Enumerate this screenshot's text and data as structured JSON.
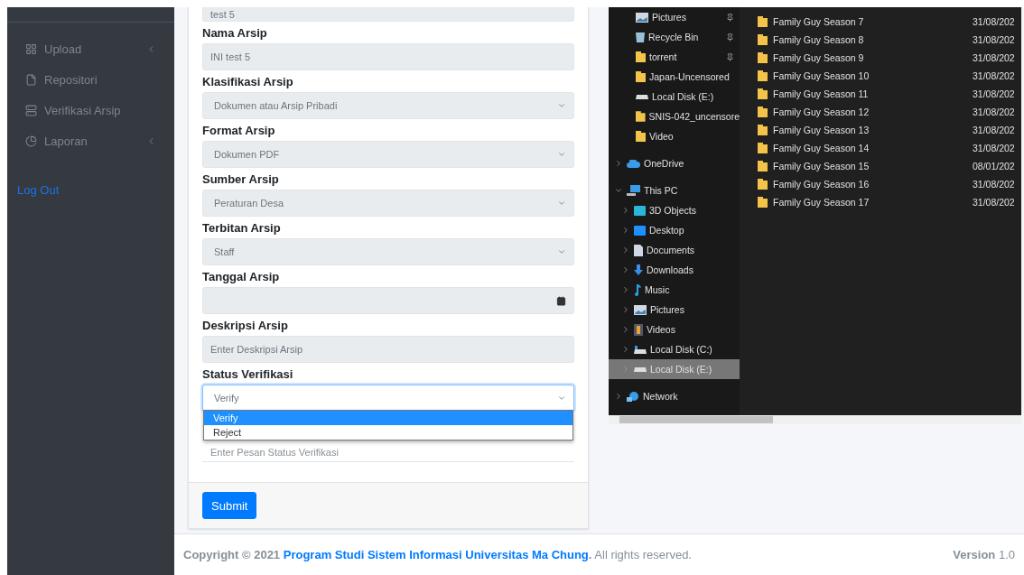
{
  "sidebar": {
    "items": [
      {
        "label": "Upload",
        "has_submenu": true
      },
      {
        "label": "Repositori",
        "has_submenu": false
      },
      {
        "label": "Verifikasi Arsip",
        "has_submenu": false
      },
      {
        "label": "Laporan",
        "has_submenu": true
      }
    ],
    "logout": "Log Out"
  },
  "form": {
    "top_value": "test 5",
    "fields": [
      {
        "label": "Nama Arsip",
        "kind": "input",
        "value": "INI test 5"
      },
      {
        "label": "Klasifikasi Arsip",
        "kind": "select",
        "value": "Dokumen atau Arsip Pribadi"
      },
      {
        "label": "Format Arsip",
        "kind": "select",
        "value": "Dokumen PDF"
      },
      {
        "label": "Sumber Arsip",
        "kind": "select",
        "value": "Peraturan Desa"
      },
      {
        "label": "Terbitan Arsip",
        "kind": "select",
        "value": "Staff"
      },
      {
        "label": "Tanggal Arsip",
        "kind": "date"
      },
      {
        "label": "Deskripsi Arsip",
        "kind": "input",
        "placeholder": "Enter Deskripsi Arsip"
      }
    ],
    "status": {
      "label": "Status Verifikasi",
      "value": "Verify",
      "options": [
        {
          "label": "Verify",
          "selected": true
        },
        {
          "label": "Reject",
          "selected": false
        }
      ]
    },
    "message_placeholder": "Enter Pesan Status Verifikasi",
    "submit": "Submit"
  },
  "explorer": {
    "nav": [
      {
        "label": "Pictures",
        "pinned": true,
        "selected": false
      },
      {
        "label": "Recycle Bin",
        "pinned": true,
        "selected": false
      },
      {
        "label": "torrent",
        "pinned": true,
        "selected": false
      },
      {
        "label": "Japan-Uncensored",
        "pinned": false,
        "selected": false
      },
      {
        "label": "Local Disk (E:)",
        "pinned": false,
        "selected": false
      },
      {
        "label": "SNIS-042_uncensore",
        "pinned": false,
        "selected": false
      },
      {
        "label": "Video",
        "pinned": false,
        "selected": false
      },
      {
        "label": "OneDrive",
        "expanded": false,
        "selected": false
      },
      {
        "label": "This PC",
        "expanded": true,
        "selected": false,
        "children": [
          {
            "label": "3D Objects",
            "selected": false
          },
          {
            "label": "Desktop",
            "selected": false
          },
          {
            "label": "Documents",
            "selected": false
          },
          {
            "label": "Downloads",
            "selected": false
          },
          {
            "label": "Music",
            "selected": false
          },
          {
            "label": "Pictures",
            "selected": false
          },
          {
            "label": "Videos",
            "selected": false
          },
          {
            "label": "Local Disk (C:)",
            "selected": false
          },
          {
            "label": "Local Disk (E:)",
            "selected": true
          }
        ]
      },
      {
        "label": "Network",
        "expanded": false,
        "selected": false
      }
    ],
    "files": [
      {
        "name": "Family Guy Season 7",
        "date": "31/08/202"
      },
      {
        "name": "Family Guy Season 8",
        "date": "31/08/202"
      },
      {
        "name": "Family Guy Season 9",
        "date": "31/08/202"
      },
      {
        "name": "Family Guy Season 10",
        "date": "31/08/202"
      },
      {
        "name": "Family Guy Season 11",
        "date": "31/08/202"
      },
      {
        "name": "Family Guy Season 12",
        "date": "31/08/202"
      },
      {
        "name": "Family Guy Season 13",
        "date": "31/08/202"
      },
      {
        "name": "Family Guy Season 14",
        "date": "31/08/202"
      },
      {
        "name": "Family Guy Season 15",
        "date": "08/01/202"
      },
      {
        "name": "Family Guy Season 16",
        "date": "31/08/202"
      },
      {
        "name": "Family Guy Season 17",
        "date": "31/08/202"
      }
    ]
  },
  "footer": {
    "copyright": "**Copyright © 2021**",
    "link": "Program Studi Sistem Informasi Universitas Ma Chung",
    "suffix": "**.** All rights reserved.",
    "version": "**Version** 1.0"
  }
}
